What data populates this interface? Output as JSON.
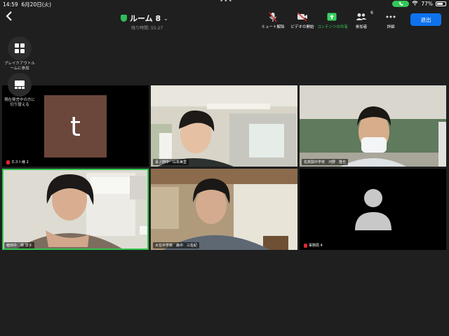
{
  "status_bar": {
    "time": "14:59",
    "date": "6月20日(火)",
    "dots": "•••",
    "call_icon": "phone",
    "battery": "77%"
  },
  "header": {
    "room_title": "ルーム 8",
    "remaining_time": "残り時間: 55:27"
  },
  "toolbar": {
    "mute": "ミュート解除",
    "video": "ビデオの開始",
    "share": "コンテンツの共有",
    "participants": "参加者",
    "participants_count": "6",
    "more": "詳細",
    "leave": "退出"
  },
  "side": {
    "breakout": "ブレイクアウトルームに参加",
    "switch": "現在発言中の方に切り替える"
  },
  "participants": [
    {
      "name": "ホスト様 2",
      "avatar_letter": "t",
      "muted": true
    },
    {
      "name": "喜ノ府中　山本美里",
      "muted": false
    },
    {
      "name": "佐賀関中学校　河野　隆也",
      "muted": false
    },
    {
      "name": "稙田中　林 洋子",
      "muted": false,
      "speaking": true
    },
    {
      "name": "大在中学校　森中　三佐紀",
      "muted": false
    },
    {
      "name": "事務局 4",
      "muted": true
    }
  ],
  "colors": {
    "accent_green": "#31c552",
    "leave_blue": "#0e72ed",
    "muted_red": "#e0282e",
    "avatar_brown": "#6b473b"
  }
}
